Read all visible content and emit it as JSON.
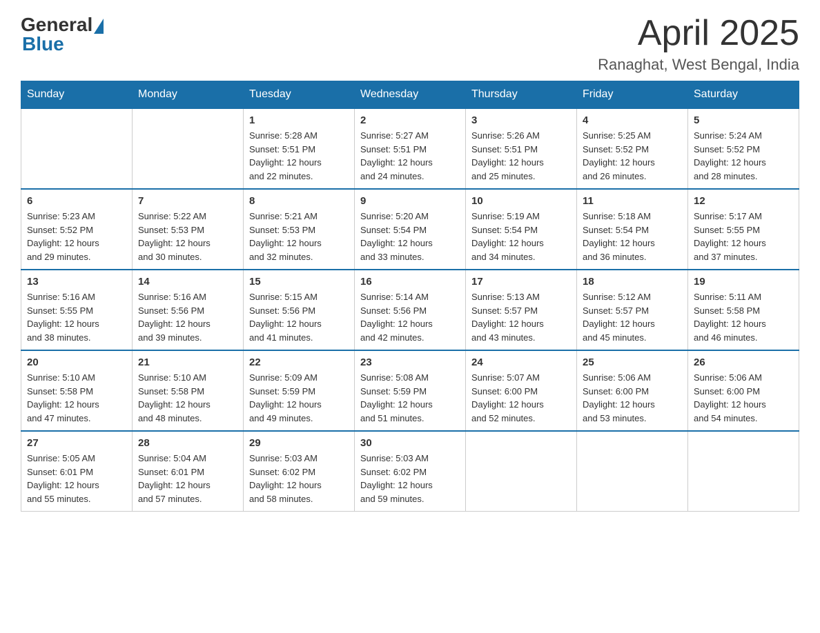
{
  "header": {
    "logo_general": "General",
    "logo_blue": "Blue",
    "month_title": "April 2025",
    "location": "Ranaghat, West Bengal, India"
  },
  "days_of_week": [
    "Sunday",
    "Monday",
    "Tuesday",
    "Wednesday",
    "Thursday",
    "Friday",
    "Saturday"
  ],
  "weeks": [
    [
      {
        "day": "",
        "info": ""
      },
      {
        "day": "",
        "info": ""
      },
      {
        "day": "1",
        "info": "Sunrise: 5:28 AM\nSunset: 5:51 PM\nDaylight: 12 hours\nand 22 minutes."
      },
      {
        "day": "2",
        "info": "Sunrise: 5:27 AM\nSunset: 5:51 PM\nDaylight: 12 hours\nand 24 minutes."
      },
      {
        "day": "3",
        "info": "Sunrise: 5:26 AM\nSunset: 5:51 PM\nDaylight: 12 hours\nand 25 minutes."
      },
      {
        "day": "4",
        "info": "Sunrise: 5:25 AM\nSunset: 5:52 PM\nDaylight: 12 hours\nand 26 minutes."
      },
      {
        "day": "5",
        "info": "Sunrise: 5:24 AM\nSunset: 5:52 PM\nDaylight: 12 hours\nand 28 minutes."
      }
    ],
    [
      {
        "day": "6",
        "info": "Sunrise: 5:23 AM\nSunset: 5:52 PM\nDaylight: 12 hours\nand 29 minutes."
      },
      {
        "day": "7",
        "info": "Sunrise: 5:22 AM\nSunset: 5:53 PM\nDaylight: 12 hours\nand 30 minutes."
      },
      {
        "day": "8",
        "info": "Sunrise: 5:21 AM\nSunset: 5:53 PM\nDaylight: 12 hours\nand 32 minutes."
      },
      {
        "day": "9",
        "info": "Sunrise: 5:20 AM\nSunset: 5:54 PM\nDaylight: 12 hours\nand 33 minutes."
      },
      {
        "day": "10",
        "info": "Sunrise: 5:19 AM\nSunset: 5:54 PM\nDaylight: 12 hours\nand 34 minutes."
      },
      {
        "day": "11",
        "info": "Sunrise: 5:18 AM\nSunset: 5:54 PM\nDaylight: 12 hours\nand 36 minutes."
      },
      {
        "day": "12",
        "info": "Sunrise: 5:17 AM\nSunset: 5:55 PM\nDaylight: 12 hours\nand 37 minutes."
      }
    ],
    [
      {
        "day": "13",
        "info": "Sunrise: 5:16 AM\nSunset: 5:55 PM\nDaylight: 12 hours\nand 38 minutes."
      },
      {
        "day": "14",
        "info": "Sunrise: 5:16 AM\nSunset: 5:56 PM\nDaylight: 12 hours\nand 39 minutes."
      },
      {
        "day": "15",
        "info": "Sunrise: 5:15 AM\nSunset: 5:56 PM\nDaylight: 12 hours\nand 41 minutes."
      },
      {
        "day": "16",
        "info": "Sunrise: 5:14 AM\nSunset: 5:56 PM\nDaylight: 12 hours\nand 42 minutes."
      },
      {
        "day": "17",
        "info": "Sunrise: 5:13 AM\nSunset: 5:57 PM\nDaylight: 12 hours\nand 43 minutes."
      },
      {
        "day": "18",
        "info": "Sunrise: 5:12 AM\nSunset: 5:57 PM\nDaylight: 12 hours\nand 45 minutes."
      },
      {
        "day": "19",
        "info": "Sunrise: 5:11 AM\nSunset: 5:58 PM\nDaylight: 12 hours\nand 46 minutes."
      }
    ],
    [
      {
        "day": "20",
        "info": "Sunrise: 5:10 AM\nSunset: 5:58 PM\nDaylight: 12 hours\nand 47 minutes."
      },
      {
        "day": "21",
        "info": "Sunrise: 5:10 AM\nSunset: 5:58 PM\nDaylight: 12 hours\nand 48 minutes."
      },
      {
        "day": "22",
        "info": "Sunrise: 5:09 AM\nSunset: 5:59 PM\nDaylight: 12 hours\nand 49 minutes."
      },
      {
        "day": "23",
        "info": "Sunrise: 5:08 AM\nSunset: 5:59 PM\nDaylight: 12 hours\nand 51 minutes."
      },
      {
        "day": "24",
        "info": "Sunrise: 5:07 AM\nSunset: 6:00 PM\nDaylight: 12 hours\nand 52 minutes."
      },
      {
        "day": "25",
        "info": "Sunrise: 5:06 AM\nSunset: 6:00 PM\nDaylight: 12 hours\nand 53 minutes."
      },
      {
        "day": "26",
        "info": "Sunrise: 5:06 AM\nSunset: 6:00 PM\nDaylight: 12 hours\nand 54 minutes."
      }
    ],
    [
      {
        "day": "27",
        "info": "Sunrise: 5:05 AM\nSunset: 6:01 PM\nDaylight: 12 hours\nand 55 minutes."
      },
      {
        "day": "28",
        "info": "Sunrise: 5:04 AM\nSunset: 6:01 PM\nDaylight: 12 hours\nand 57 minutes."
      },
      {
        "day": "29",
        "info": "Sunrise: 5:03 AM\nSunset: 6:02 PM\nDaylight: 12 hours\nand 58 minutes."
      },
      {
        "day": "30",
        "info": "Sunrise: 5:03 AM\nSunset: 6:02 PM\nDaylight: 12 hours\nand 59 minutes."
      },
      {
        "day": "",
        "info": ""
      },
      {
        "day": "",
        "info": ""
      },
      {
        "day": "",
        "info": ""
      }
    ]
  ]
}
